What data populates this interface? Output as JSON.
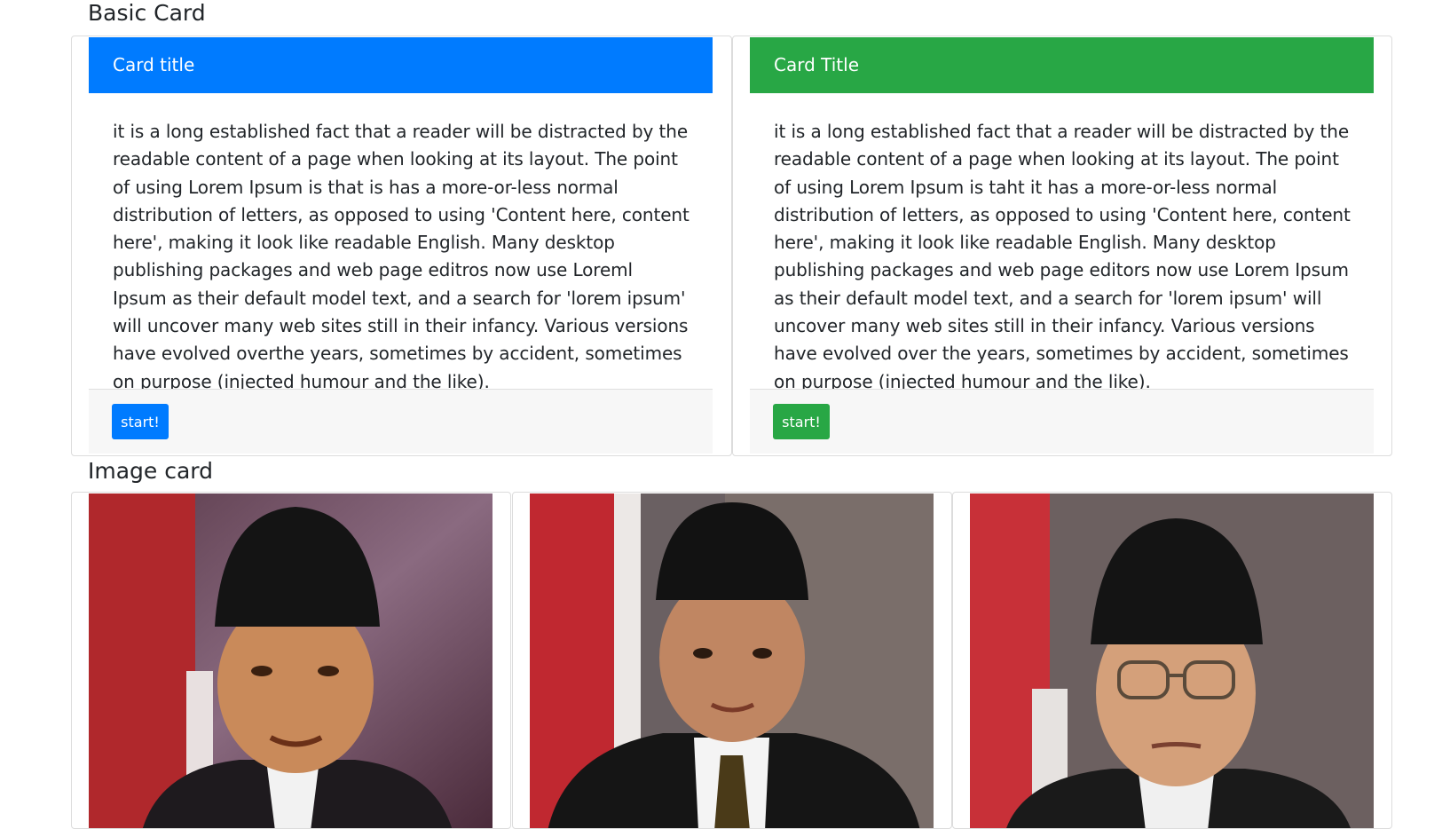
{
  "basic_section": {
    "title": "Basic Card",
    "cards": [
      {
        "header": "Card title",
        "body": "it is a long established fact that a reader will be distracted by the readable content of a page when looking at its layout. The point of using Lorem Ipsum is that is has a more-or-less normal distribution of letters, as opposed to using 'Content here, content here', making it look like readable English. Many desktop publishing packages and web page editros now use Loreml Ipsum as their default model text, and a search for 'lorem ipsum' will uncover many web sites still in their infancy. Various versions have evolved overthe years, sometimes by accident, sometimes on purpose (injected humour and the like).",
        "button": "start!",
        "accent": "#007bff"
      },
      {
        "header": "Card Title",
        "body": "it is a long established fact that a reader will be distracted by the readable content of a page when looking at its layout. The point of using Lorem Ipsum is taht it has a more-or-less normal distribution of letters, as opposed to using 'Content here, content here', making it look like readable English. Many desktop publishing packages and web page editors now use Lorem Ipsum as their default model text, and a search for 'lorem ipsum' will uncover many web sites still in their infancy. Various versions have evolved over the years, sometimes by accident, sometimes on purpose (injected humour and the like).",
        "button": "start!",
        "accent": "#28a745"
      }
    ]
  },
  "image_section": {
    "title": "Image card",
    "images": [
      {
        "icon": "portrait-photo-1"
      },
      {
        "icon": "portrait-photo-2"
      },
      {
        "icon": "portrait-photo-3"
      }
    ]
  }
}
